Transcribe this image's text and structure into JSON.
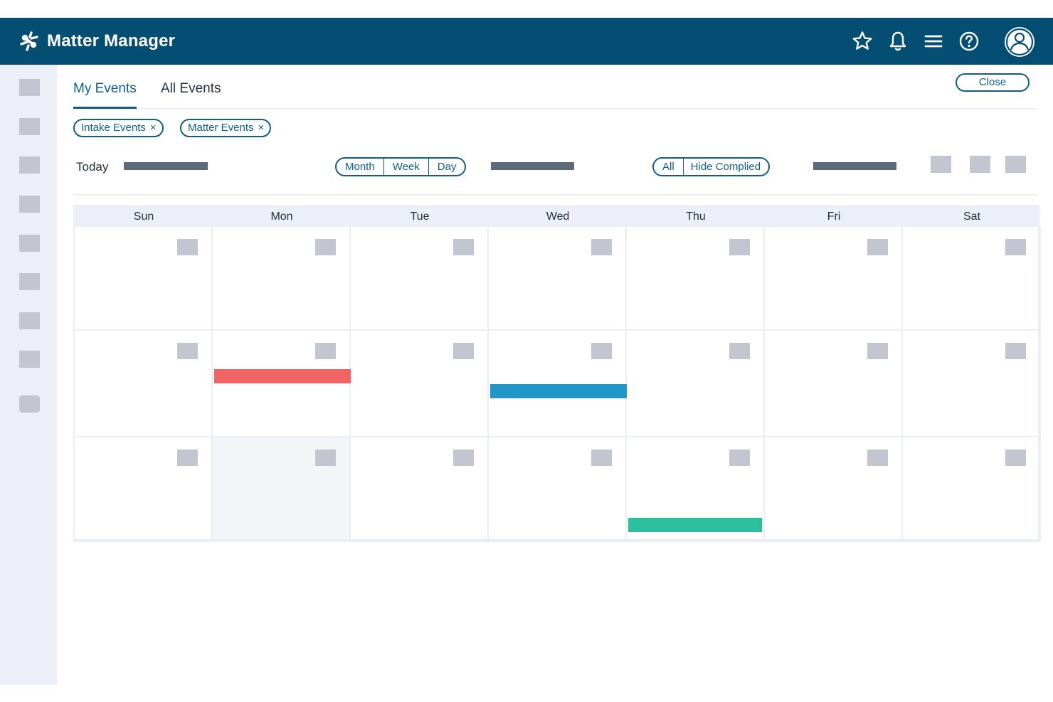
{
  "app": {
    "title": "Matter Manager"
  },
  "header_icons": [
    "star-icon",
    "bell-icon",
    "menu-icon",
    "help-icon",
    "user-avatar-icon"
  ],
  "tabs": [
    {
      "label": "My Events",
      "active": true
    },
    {
      "label": "All Events",
      "active": false
    }
  ],
  "close_label": "Close",
  "filters": [
    {
      "label": "Intake Events",
      "remove": "×"
    },
    {
      "label": "Matter Events",
      "remove": "×"
    }
  ],
  "toolbar": {
    "today_label": "Today",
    "view_options": [
      "Month",
      "Week",
      "Day"
    ],
    "status_options": [
      "All",
      "Hide Complied"
    ]
  },
  "calendar": {
    "days": [
      "Sun",
      "Mon",
      "Tue",
      "Wed",
      "Thu",
      "Fri",
      "Sat"
    ],
    "weeks": 3,
    "highlighted_cell": {
      "week": 3,
      "day": "Mon"
    },
    "events": [
      {
        "week": 2,
        "day": "Mon",
        "color": "#f26464"
      },
      {
        "week": 2,
        "day": "Wed",
        "color": "#2196c9"
      },
      {
        "week": 3,
        "day": "Thu",
        "color": "#2bbf9d"
      }
    ]
  },
  "colors": {
    "header_bg": "#044e73",
    "accent": "#0e5e87",
    "sidebar_bg": "#eceef8",
    "placeholder": "#c3c6d0"
  }
}
